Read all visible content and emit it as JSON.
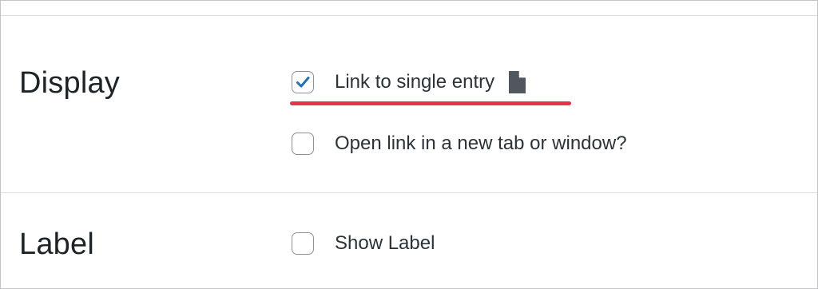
{
  "display": {
    "heading": "Display",
    "options": [
      {
        "label": "Link to single entry",
        "checked": true,
        "icon": "document-icon"
      },
      {
        "label": "Open link in a new tab or window?",
        "checked": false
      }
    ]
  },
  "label_section": {
    "heading": "Label",
    "options": [
      {
        "label": "Show Label",
        "checked": false
      }
    ]
  },
  "colors": {
    "checkmark": "#2271b1",
    "highlight_underline": "#e8334a",
    "text": "#2c3338",
    "border": "#c3c4c7"
  }
}
